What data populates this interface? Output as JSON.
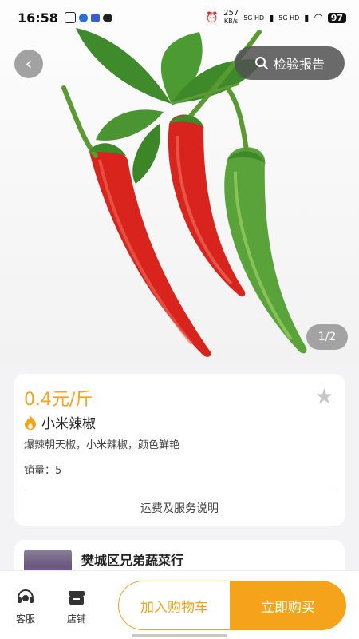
{
  "status_bar": {
    "time": "16:58",
    "network_speed": "257",
    "network_unit": "KB/s",
    "signal_1": "5G HD",
    "signal_2": "5G HD",
    "battery": "97"
  },
  "header": {
    "report_label": "检验报告"
  },
  "gallery": {
    "pager": "1/2"
  },
  "product": {
    "price": "0.4元/斤",
    "name": "小米辣椒",
    "description": "爆辣朝天椒，小米辣椒，颜色鲜艳",
    "sales_label": "销量：",
    "sales_value": "5",
    "shipping_label": "运费及服务说明"
  },
  "shop": {
    "name": "樊城区兄弟蔬菜行"
  },
  "bottom_bar": {
    "service_label": "客服",
    "store_label": "店铺",
    "add_to_cart_label": "加入购物车",
    "buy_now_label": "立即购买"
  },
  "colors": {
    "accent": "#f5a31a",
    "red_pepper": "#d8241c",
    "green_pepper": "#5aa33a"
  }
}
